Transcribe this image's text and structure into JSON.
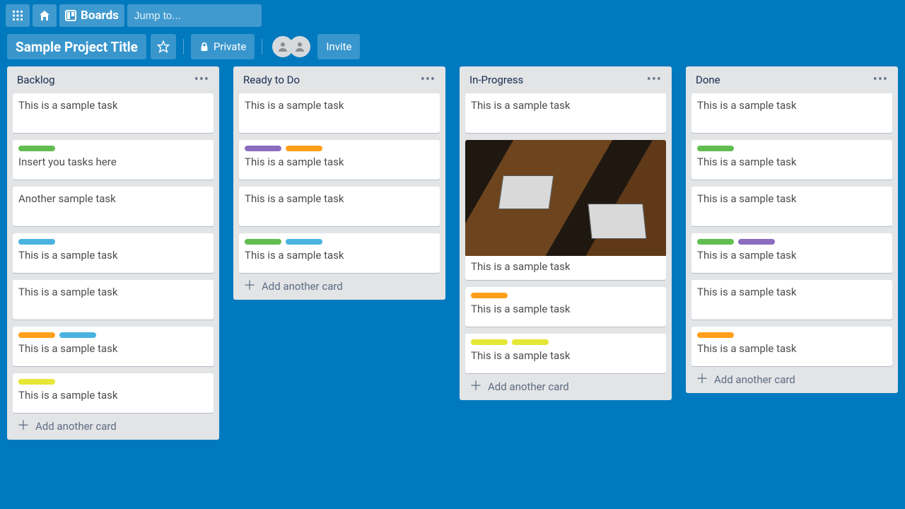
{
  "header": {
    "boards_label": "Boards",
    "search_placeholder": "Jump to..."
  },
  "board": {
    "title": "Sample Project Title",
    "visibility": "Private",
    "invite_label": "Invite"
  },
  "add_card_label": "Add another card",
  "label_colors": {
    "green": "#61bd4f",
    "purple": "#8b6cbf",
    "orange": "#ff9f1a",
    "blue": "#4ab3e0",
    "yellow": "#e6e635"
  },
  "lists": [
    {
      "title": "Backlog",
      "cards": [
        {
          "text": "This is a sample task",
          "labels": []
        },
        {
          "text": "Insert you tasks here",
          "labels": [
            "green"
          ]
        },
        {
          "text": "Another sample task",
          "labels": []
        },
        {
          "text": "This is a sample task",
          "labels": [
            "blue"
          ]
        },
        {
          "text": "This is a sample task",
          "labels": []
        },
        {
          "text": "This is a sample task",
          "labels": [
            "orange",
            "blue"
          ]
        },
        {
          "text": "This is a sample task",
          "labels": [
            "yellow"
          ]
        }
      ]
    },
    {
      "title": "Ready to Do",
      "cards": [
        {
          "text": "This is a sample task",
          "labels": []
        },
        {
          "text": "This is a sample task",
          "labels": [
            "purple",
            "orange"
          ]
        },
        {
          "text": "This is a sample task",
          "labels": []
        },
        {
          "text": "This is a sample task",
          "labels": [
            "green",
            "blue"
          ]
        }
      ]
    },
    {
      "title": "In-Progress",
      "cards": [
        {
          "text": "This is a sample task",
          "labels": []
        },
        {
          "text": "This is a sample task",
          "labels": [],
          "image": true
        },
        {
          "text": "This is a sample task",
          "labels": [
            "orange"
          ]
        },
        {
          "text": "This is a sample task",
          "labels": [
            "yellow",
            "yellow"
          ]
        }
      ]
    },
    {
      "title": "Done",
      "cards": [
        {
          "text": "This is a sample task",
          "labels": []
        },
        {
          "text": "This is a sample task",
          "labels": [
            "green"
          ]
        },
        {
          "text": "This is a sample task",
          "labels": []
        },
        {
          "text": "This is a sample task",
          "labels": [
            "green",
            "purple"
          ]
        },
        {
          "text": "This is a sample task",
          "labels": []
        },
        {
          "text": "This is a sample task",
          "labels": [
            "orange"
          ]
        }
      ]
    }
  ]
}
